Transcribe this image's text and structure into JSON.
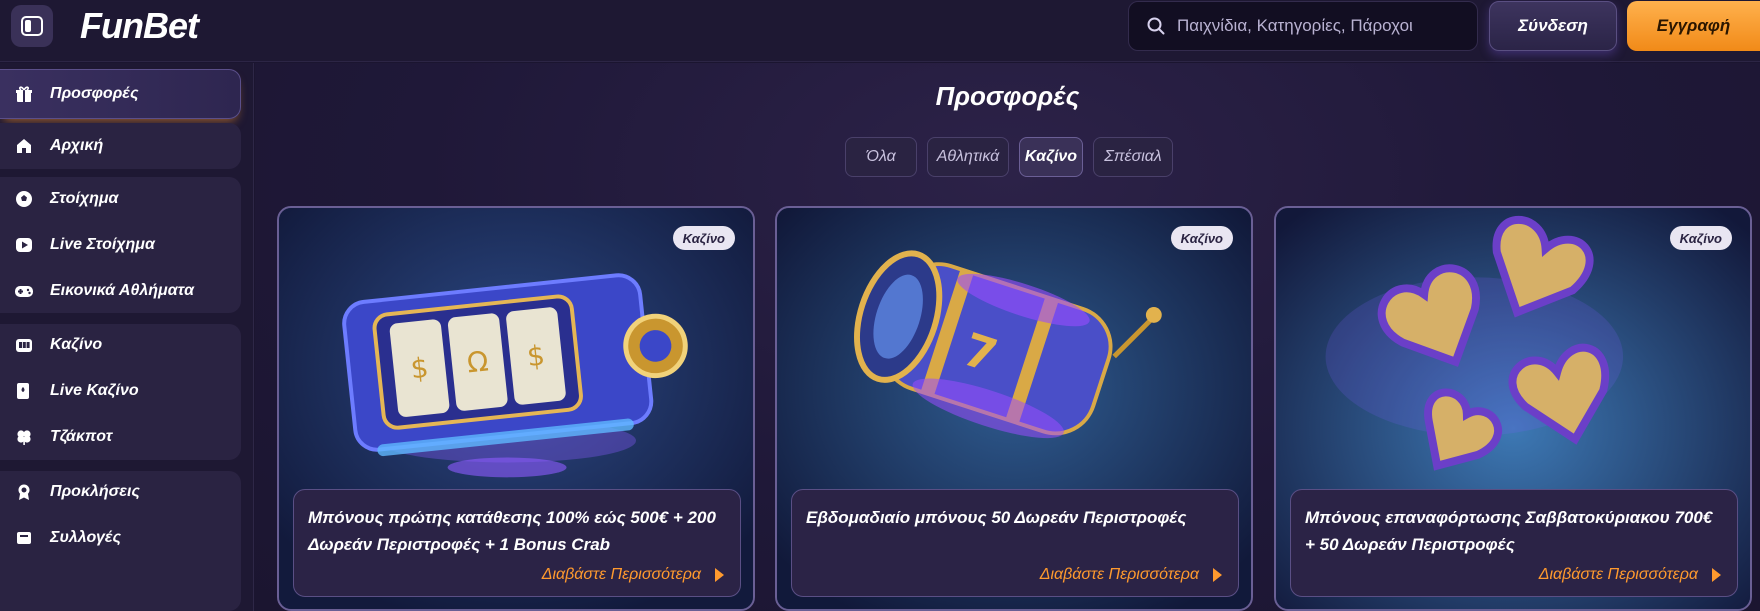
{
  "header": {
    "logo": "FunBet",
    "search_placeholder": "Παιχνίδια, Κατηγορίες, Πάροχοι",
    "login_label": "Σύνδεση",
    "register_label": "Εγγραφή"
  },
  "sidebar": {
    "items": [
      {
        "label": "Προσφορές",
        "icon": "gift-icon",
        "active": true
      },
      {
        "label": "Αρχική",
        "icon": "home-icon"
      },
      {
        "label": "Στοίχημα",
        "icon": "soccer-ball-icon"
      },
      {
        "label": "Live Στοίχημα",
        "icon": "play-icon"
      },
      {
        "label": "Εικονικά Αθλήματα",
        "icon": "gamepad-icon"
      },
      {
        "label": "Καζίνο",
        "icon": "slot-machine-icon"
      },
      {
        "label": "Live Καζίνο",
        "icon": "cards-icon"
      },
      {
        "label": "Τζάκποτ",
        "icon": "clover-icon"
      },
      {
        "label": "Προκλήσεις",
        "icon": "medal-icon"
      },
      {
        "label": "Συλλογές",
        "icon": "collection-icon"
      }
    ]
  },
  "main": {
    "title": "Προσφορές",
    "tabs": [
      {
        "label": "Όλα"
      },
      {
        "label": "Αθλητικά"
      },
      {
        "label": "Καζίνο",
        "active": true
      },
      {
        "label": "Σπέσιαλ"
      }
    ],
    "cards": [
      {
        "badge": "Καζίνο",
        "title": "Μπόνους πρώτης κατάθεσης 100% εώς 500€ + 200 Δωρεάν Περιστροφές + 1 Bonus Crab",
        "link": "Διαβάστε Περισσότερα"
      },
      {
        "badge": "Καζίνο",
        "title": "Εβδομαδιαίο μπόνους 50 Δωρεάν Περιστροφές",
        "link": "Διαβάστε Περισσότερα"
      },
      {
        "badge": "Καζίνο",
        "title": "Μπόνους επαναφόρτωσης Σαββατοκύριακου 700€ + 50 Δωρεάν Περιστροφές",
        "link": "Διαβάστε Περισσότερα"
      }
    ]
  },
  "colors": {
    "accent": "#ff9a2e",
    "background": "#1b1530",
    "panel": "#2a2342"
  }
}
